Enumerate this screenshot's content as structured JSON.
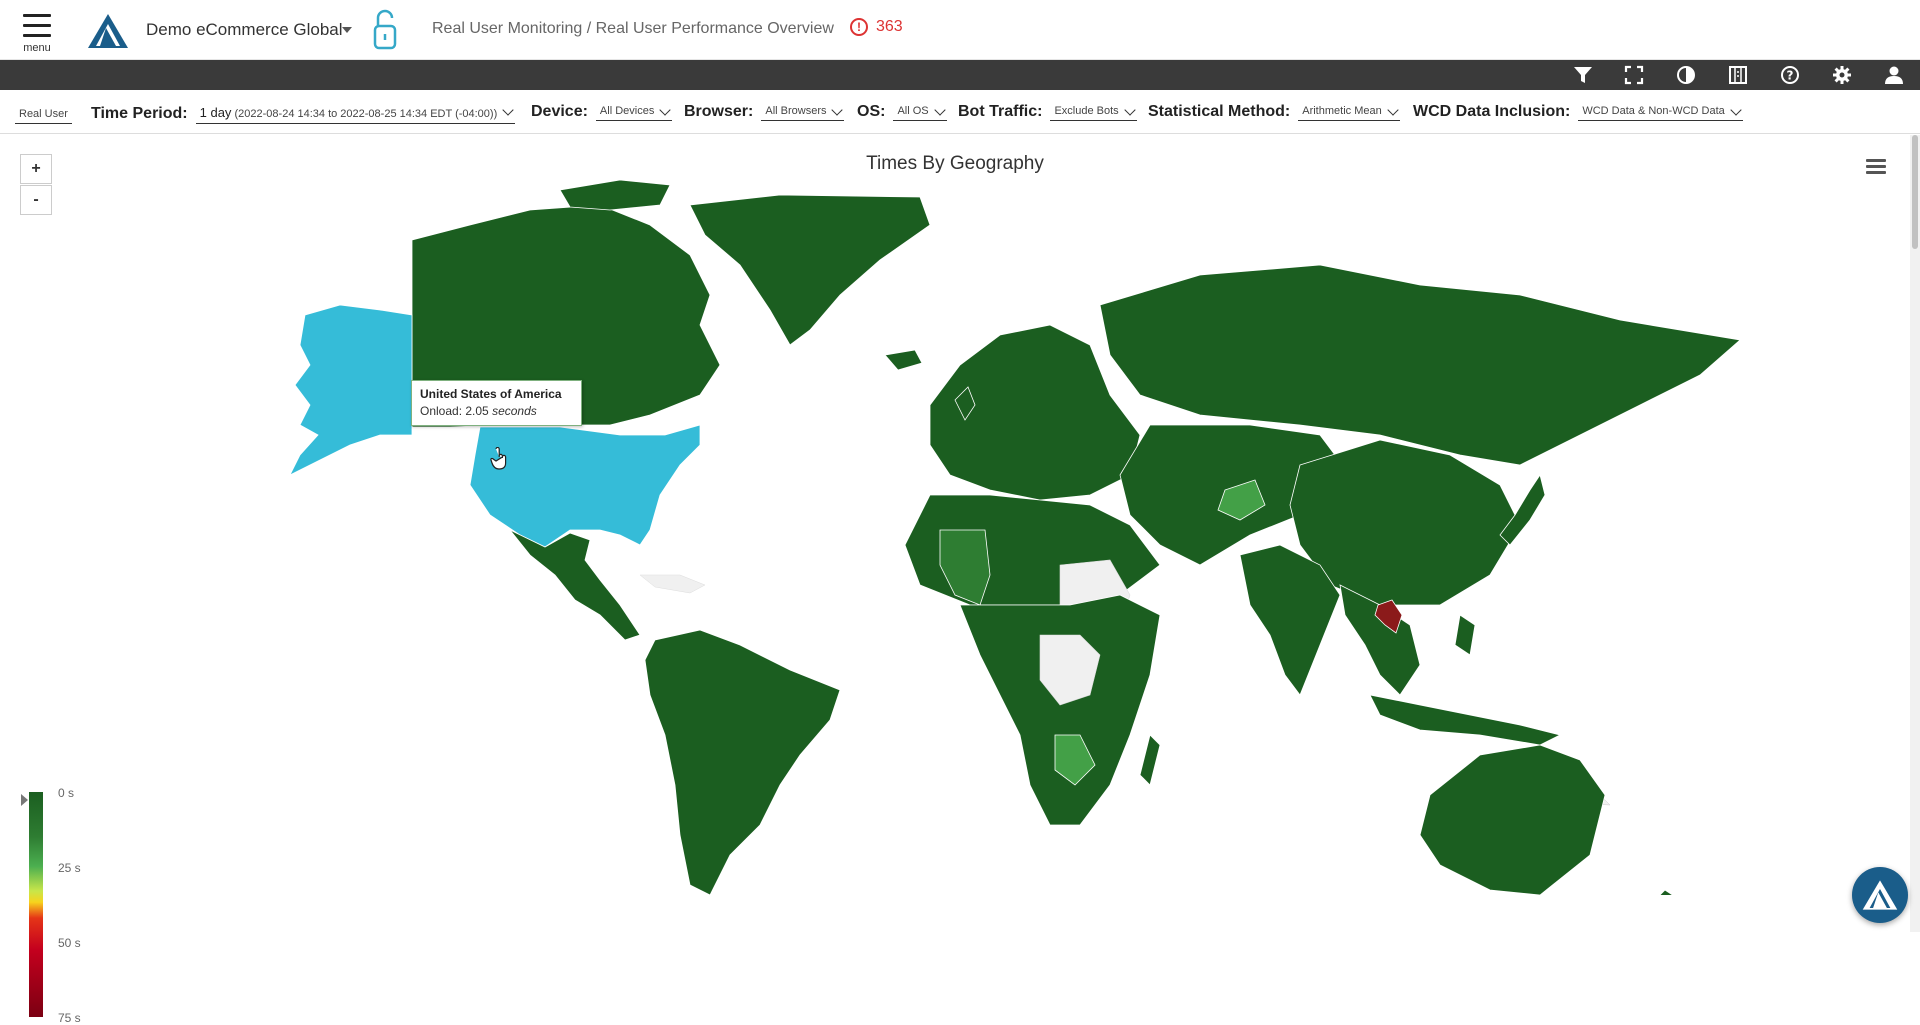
{
  "header": {
    "menu_label": "menu",
    "tenant": "Demo eCommerce Global",
    "breadcrumb": "Real User Monitoring / Real User Performance Overview",
    "alert_count": "363"
  },
  "toolbar": {
    "icons": [
      "filter-icon",
      "fullscreen-icon",
      "contrast-icon",
      "report-icon",
      "help-icon",
      "settings-icon",
      "user-icon"
    ]
  },
  "filters": {
    "real_user": "Real User",
    "time_period": {
      "label": "Time Period:",
      "value": "1 day",
      "detail": "(2022-08-24 14:34 to 2022-08-25 14:34 EDT (-04:00))"
    },
    "device": {
      "label": "Device:",
      "value": "All Devices"
    },
    "browser": {
      "label": "Browser:",
      "value": "All Browsers"
    },
    "os": {
      "label": "OS:",
      "value": "All OS"
    },
    "bot": {
      "label": "Bot Traffic:",
      "value": "Exclude Bots"
    },
    "stat": {
      "label": "Statistical Method:",
      "value": "Arithmetic Mean"
    },
    "wcd": {
      "label": "WCD Data Inclusion:",
      "value": "WCD Data & Non-WCD Data"
    }
  },
  "chart": {
    "title": "Times By Geography",
    "zoom_in": "+",
    "zoom_out": "-",
    "tooltip": {
      "country": "United States of America",
      "metric": "Onload: 2.05",
      "unit": "seconds"
    },
    "legend_ticks": [
      "0 s",
      "25 s",
      "50 s",
      "75 s"
    ],
    "colors": {
      "dark_green": "#1b5e20",
      "mid_green": "#2e7d32",
      "light_green": "#43a047",
      "highlight": "#35bcd8",
      "no_data": "#f0f0f0",
      "red": "#8b1a1a"
    }
  }
}
